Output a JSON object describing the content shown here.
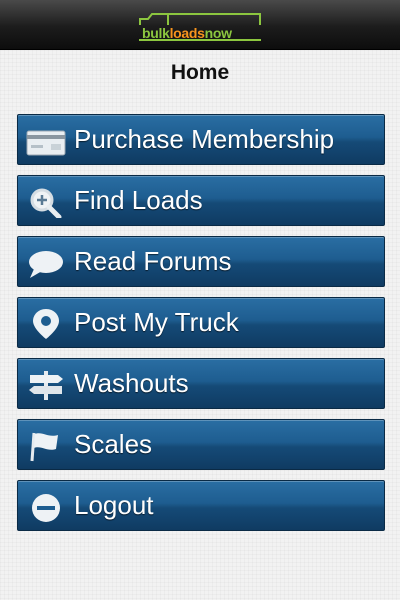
{
  "header": {
    "logo_left": "bulk",
    "logo_mid": "loads",
    "logo_right": "now"
  },
  "page": {
    "title": "Home"
  },
  "menu": {
    "items": [
      {
        "label": "Purchase Membership",
        "icon": "credit-card-icon"
      },
      {
        "label": "Find Loads",
        "icon": "search-plus-icon"
      },
      {
        "label": "Read Forums",
        "icon": "speech-bubble-icon"
      },
      {
        "label": "Post My Truck",
        "icon": "map-pin-icon"
      },
      {
        "label": "Washouts",
        "icon": "signpost-icon"
      },
      {
        "label": "Scales",
        "icon": "flag-icon"
      },
      {
        "label": "Logout",
        "icon": "minus-circle-icon"
      }
    ]
  },
  "colors": {
    "button_top": "#2a6ea3",
    "button_bottom": "#0f3b62",
    "logo_green": "#8cc63f",
    "logo_orange": "#f7941d"
  }
}
